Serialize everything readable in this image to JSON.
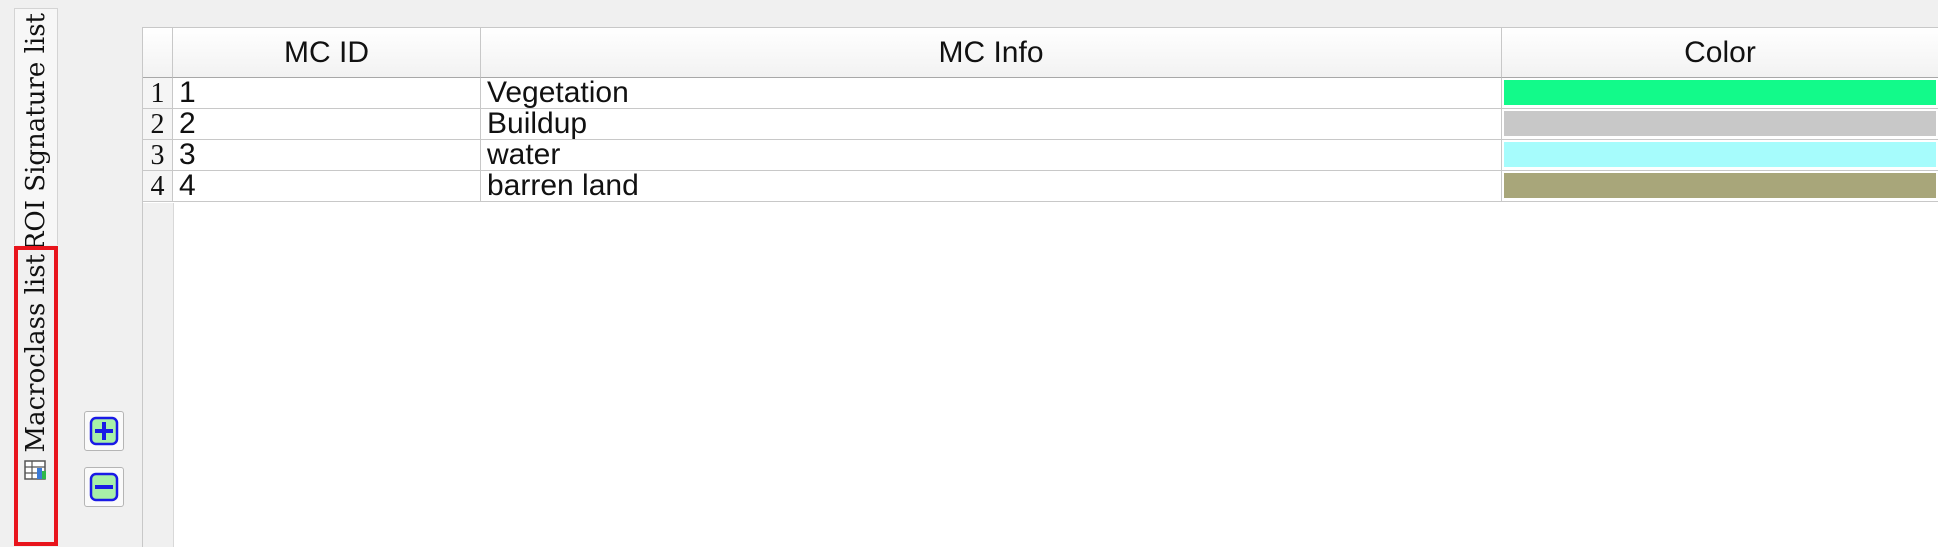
{
  "tabs": [
    {
      "label": "ROI Signature list",
      "icon": "roi-signature-icon"
    },
    {
      "label": "Macroclass list",
      "icon": "macroclass-table-icon",
      "selected": true
    }
  ],
  "toolbar": {
    "add": {
      "icon": "plus-icon"
    },
    "remove": {
      "icon": "minus-icon"
    }
  },
  "table": {
    "headers": {
      "mc_id": "MC ID",
      "mc_info": "MC Info",
      "color": "Color"
    },
    "rows": [
      {
        "row_number": "1",
        "mc_id": "1",
        "mc_info": "Vegetation",
        "color": "#12fa8a"
      },
      {
        "row_number": "2",
        "mc_id": "2",
        "mc_info": "Buildup",
        "color": "#c8c8c8"
      },
      {
        "row_number": "3",
        "mc_id": "3",
        "mc_info": "water",
        "color": "#a6fcfc"
      },
      {
        "row_number": "4",
        "mc_id": "4",
        "mc_info": "barren land",
        "color": "#a8a67a"
      }
    ]
  },
  "colors": {
    "highlight_border": "#e8141c",
    "button_icon": "#1a1ae6",
    "button_icon_bg": "#a8f0a8"
  }
}
